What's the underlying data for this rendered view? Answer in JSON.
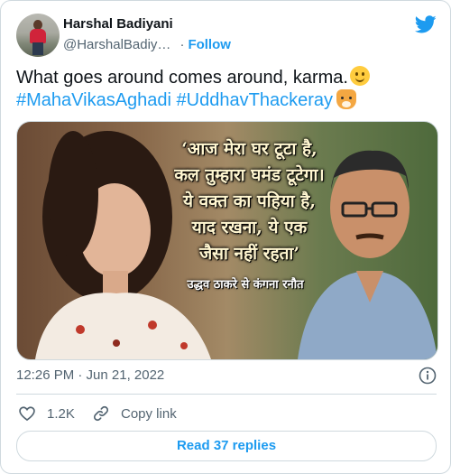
{
  "author": {
    "display_name": "Harshal Badiyani",
    "handle": "@HarshalBadiy…",
    "separator": "·",
    "follow_label": "Follow"
  },
  "tweet": {
    "text_plain": "What goes around comes around, karma.",
    "hashtag_1": "#MahaVikasAghadi",
    "hashtag_2": "#UddhavThackeray",
    "emoji_1": "slightly-smiling-face",
    "emoji_2": "tiger-face"
  },
  "media": {
    "quote_lines": [
      "‘आज मेरा घर टूटा है,",
      "कल तुम्हारा घमंड टूटेगा।",
      "ये वक्त का पहिया है,",
      "याद रखना, ये एक",
      "जैसा नहीं रहता’"
    ],
    "caption": "उद्धव ठाकरे से कंगना रनौत"
  },
  "meta": {
    "timestamp": "12:26 PM · Jun 21, 2022"
  },
  "actions": {
    "like_count": "1.2K",
    "copy_link_label": "Copy link"
  },
  "replies": {
    "label": "Read 37 replies"
  },
  "colors": {
    "accent": "#1d9bf0",
    "text_primary": "#0f1419",
    "text_secondary": "#536471",
    "border": "#cfd9de"
  },
  "icons": [
    "twitter-bird-icon",
    "info-icon",
    "heart-icon",
    "link-icon"
  ]
}
